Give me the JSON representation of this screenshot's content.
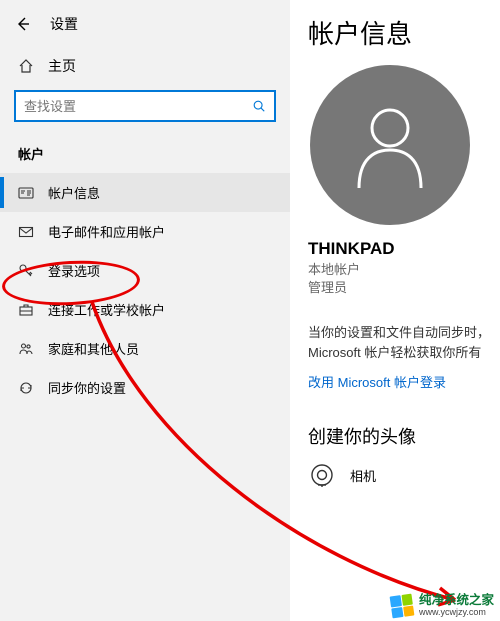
{
  "header": {
    "settings_label": "设置"
  },
  "sidebar": {
    "home_label": "主页",
    "search_placeholder": "查找设置",
    "section_label": "帐户",
    "items": [
      {
        "label": "帐户信息",
        "icon": "id-card-icon",
        "active": true
      },
      {
        "label": "电子邮件和应用帐户",
        "icon": "mail-icon",
        "active": false
      },
      {
        "label": "登录选项",
        "icon": "key-icon",
        "active": false
      },
      {
        "label": "连接工作或学校帐户",
        "icon": "briefcase-icon",
        "active": false
      },
      {
        "label": "家庭和其他人员",
        "icon": "people-icon",
        "active": false
      },
      {
        "label": "同步你的设置",
        "icon": "sync-icon",
        "active": false
      }
    ]
  },
  "main": {
    "title": "帐户信息",
    "user_name": "THINKPAD",
    "user_line1": "本地帐户",
    "user_line2": "管理员",
    "sync_desc_l1": "当你的设置和文件自动同步时，",
    "sync_desc_l2": "Microsoft 帐户轻松获取你所有",
    "sign_in_link": "改用 Microsoft 帐户登录",
    "subtitle": "创建你的头像",
    "camera_label": "相机"
  },
  "watermark": {
    "brand": "纯净系统之家",
    "url": "www.ycwjzy.com"
  },
  "annotation": {
    "colors": {
      "stroke": "#e60000"
    }
  }
}
